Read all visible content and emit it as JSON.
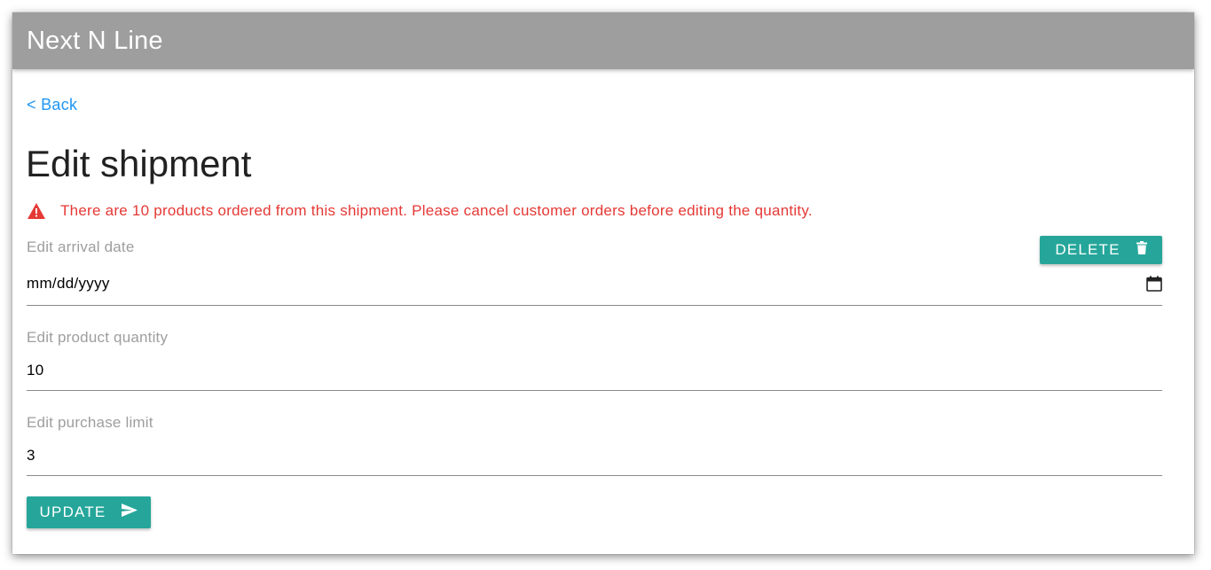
{
  "app": {
    "title": "Next N Line"
  },
  "nav": {
    "back_label": "< Back"
  },
  "page": {
    "title": "Edit shipment"
  },
  "alert": {
    "icon": "warning-icon",
    "message": "There are 10 products ordered from this shipment. Please cancel customer orders before editing the quantity.",
    "color": "#e53935"
  },
  "actions": {
    "delete_label": "DELETE",
    "delete_icon": "trash-icon",
    "update_label": "UPDATE",
    "update_icon": "send-icon"
  },
  "form": {
    "arrival_date": {
      "label": "Edit arrival date",
      "value": "mm/dd/yyyy",
      "icon": "calendar-icon"
    },
    "product_quantity": {
      "label": "Edit product quantity",
      "value": "10"
    },
    "purchase_limit": {
      "label": "Edit purchase limit",
      "value": "3"
    }
  },
  "colors": {
    "appbar": "#9e9e9e",
    "accent": "#26a69a",
    "link": "#2196f3",
    "error": "#e53935"
  }
}
